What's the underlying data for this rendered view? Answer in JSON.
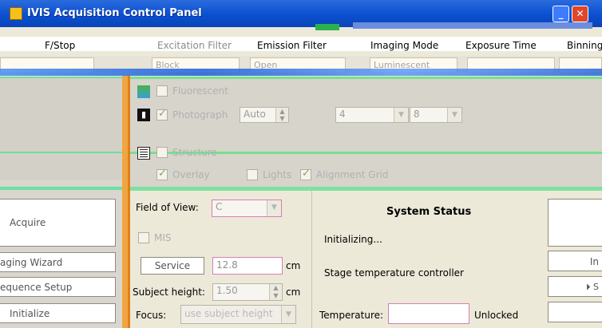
{
  "window": {
    "title": "IVIS Acquisition Control Panel"
  },
  "header": {
    "fstop": "F/Stop",
    "excitation": "Excitation Filter",
    "emission": "Emission Filter",
    "imaging_mode": "Imaging Mode",
    "exposure_time": "Exposure Time",
    "binning": "Binning"
  },
  "ghost_row": {
    "excitation_value": "Block",
    "emission_value": "Open",
    "mode_value": "Luminescent"
  },
  "imaging": {
    "fluorescent_label": "Fluorescent",
    "photograph_label": "Photograph",
    "photo_exposure": "Auto",
    "photo_binning": "4",
    "photo_fstop": "8",
    "structure_label": "Structure",
    "overlay_label": "Overlay",
    "lights_label": "Lights",
    "alignment_grid_label": "Alignment Grid"
  },
  "left_buttons": {
    "acquire": "Acquire",
    "imaging_wizard": "aging Wizard",
    "sequence_setup": "equence Setup",
    "initialize": "Initialize"
  },
  "settings": {
    "fov_label": "Field of View:",
    "fov_value": "C",
    "mis_label": "MIS",
    "service_label": "Service",
    "service_value": "12.8",
    "service_unit": "cm",
    "subject_height_label": "Subject height:",
    "subject_height_value": "1.50",
    "subject_height_unit": "cm",
    "focus_label": "Focus:",
    "focus_value": "use subject height"
  },
  "system_status": {
    "title": "System Status",
    "line1": "Initializing...",
    "line2": "Stage temperature controller",
    "temperature_label": "Temperature:",
    "temperature_state": "Unlocked"
  },
  "right_buttons": {
    "btn2": "In",
    "btn3": "⏵ S"
  }
}
